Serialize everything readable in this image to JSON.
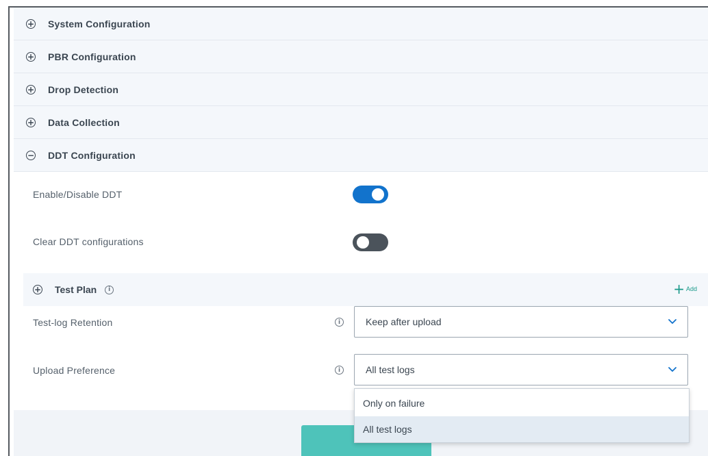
{
  "sections": [
    {
      "label": "System Configuration",
      "expanded": false
    },
    {
      "label": "PBR Configuration",
      "expanded": false
    },
    {
      "label": "Drop Detection",
      "expanded": false
    },
    {
      "label": "Data Collection",
      "expanded": false
    },
    {
      "label": "DDT Configuration",
      "expanded": true
    }
  ],
  "ddt": {
    "enable_label": "Enable/Disable DDT",
    "enable_state": true,
    "clear_label": "Clear DDT configurations",
    "clear_state": false
  },
  "test_plan": {
    "label": "Test Plan",
    "add_label": "Add"
  },
  "retention": {
    "label": "Test-log Retention",
    "value": "Keep after upload"
  },
  "upload": {
    "label": "Upload Preference",
    "value": "All test logs",
    "options": [
      "Only on failure",
      "All test logs"
    ],
    "highlighted": "All test logs"
  },
  "icons": {
    "expand": "plus-circle-icon",
    "collapse": "minus-circle-icon",
    "info": "info-icon",
    "chevron": "chevron-down-icon",
    "add": "plus-icon"
  },
  "colors": {
    "toggle_on": "#1273cc",
    "toggle_off": "#4b535b",
    "accent_teal": "#4ec3ba",
    "chevron": "#1273cc"
  }
}
